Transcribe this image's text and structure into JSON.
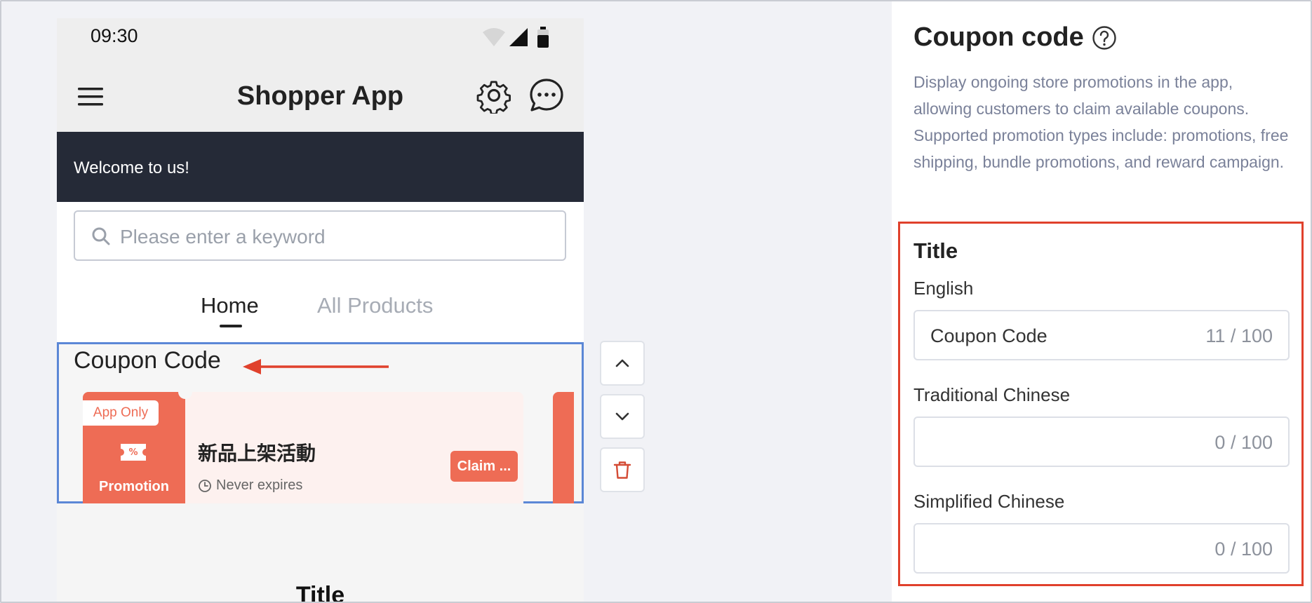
{
  "status_bar": {
    "time": "09:30"
  },
  "app_header": {
    "title": "Shopper App"
  },
  "banner": {
    "text": "Welcome to us!"
  },
  "search": {
    "placeholder": "Please enter a keyword"
  },
  "tabs": [
    {
      "label": "Home",
      "active": true
    },
    {
      "label": "All Products",
      "active": false
    }
  ],
  "coupon_section": {
    "heading": "Coupon Code",
    "card": {
      "badge": "App Only",
      "type_label": "Promotion",
      "name": "新品上架活動",
      "expiry": "Never expires",
      "claim_label": "Claim ..."
    }
  },
  "title_section": {
    "text": "Title"
  },
  "panel": {
    "title": "Coupon code",
    "description": "Display ongoing store promotions in the app, allowing customers to claim available coupons. Supported promotion types include: promotions, free shipping, bundle promotions, and reward campaign.",
    "section_title": "Title",
    "fields": [
      {
        "label": "English",
        "value": "Coupon Code",
        "counter": "11 / 100"
      },
      {
        "label": "Traditional Chinese",
        "value": "",
        "counter": "0 / 100"
      },
      {
        "label": "Simplified Chinese",
        "value": "",
        "counter": "0 / 100"
      }
    ]
  },
  "colors": {
    "accent_coupon": "#ee6c55",
    "selection_border": "#5b87d6",
    "highlight_border": "#e0412c",
    "banner_bg": "#252a37"
  },
  "icons": [
    "wifi-icon",
    "signal-icon",
    "battery-icon",
    "menu-icon",
    "gear-icon",
    "chat-icon",
    "search-icon",
    "ticket-icon",
    "clock-icon",
    "chevron-up-icon",
    "chevron-down-icon",
    "trash-icon",
    "help-icon",
    "arrow-icon"
  ]
}
